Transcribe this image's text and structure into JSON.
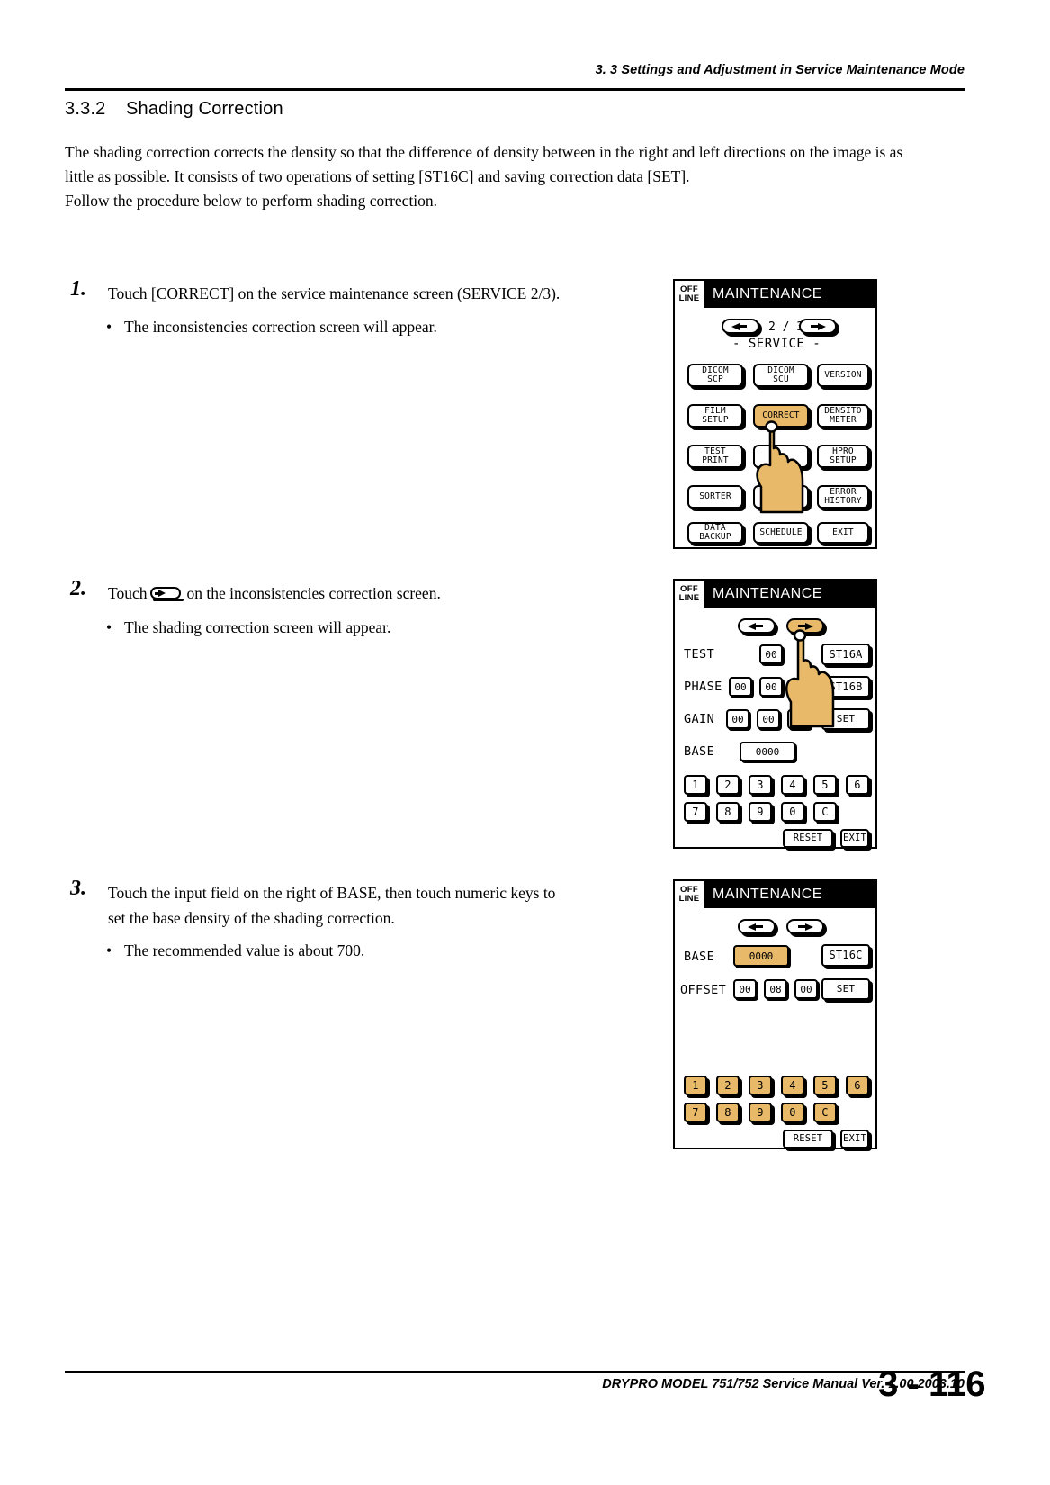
{
  "header": {
    "running_head": "3. 3 Settings and Adjustment in Service Maintenance Mode"
  },
  "section": {
    "number": "3.3.2",
    "title": "Shading Correction"
  },
  "intro": {
    "line1": "The shading correction corrects the density so that the difference of density between in the right and left directions on the image is as",
    "line2": "little as possible. It consists of two operations of setting [ST16C] and saving correction data [SET].",
    "line3": "Follow the procedure below to perform shading correction."
  },
  "steps": [
    {
      "number": "1.",
      "text": "Touch [CORRECT] on the service maintenance screen (SERVICE 2/3).",
      "bullet": "The inconsistencies correction screen will appear."
    },
    {
      "number": "2.",
      "text_before": "Touch",
      "text_after": "on the inconsistencies correction screen.",
      "bullet": "The shading correction screen will appear."
    },
    {
      "number": "3.",
      "text_line1": "Touch the input field on the right of BASE, then touch numeric keys to",
      "text_line2": "set the base density of the shading correction.",
      "bullet": "The recommended value is about 700."
    }
  ],
  "panel1": {
    "offline": {
      "line1": "OFF",
      "line2": "LINE"
    },
    "title": "MAINTENANCE",
    "page_indicator": "2 / 3",
    "service_label": "- SERVICE -",
    "buttons": [
      {
        "label1": "DICOM",
        "label2": "SCP",
        "highlight": false
      },
      {
        "label1": "DICOM",
        "label2": "SCU",
        "highlight": false
      },
      {
        "label1": "VERSION",
        "label2": "",
        "highlight": false
      },
      {
        "label1": "FILM",
        "label2": "SETUP",
        "highlight": false
      },
      {
        "label1": "CORRECT",
        "label2": "",
        "highlight": true
      },
      {
        "label1": "DENSITO",
        "label2": "METER",
        "highlight": false
      },
      {
        "label1": "TEST",
        "label2": "PRINT",
        "highlight": false
      },
      {
        "label1": "",
        "label2": "",
        "highlight": false
      },
      {
        "label1": "HPRO",
        "label2": "SETUP",
        "highlight": false
      },
      {
        "label1": "SORTER",
        "label2": "",
        "highlight": false
      },
      {
        "label1": "",
        "label2": "",
        "highlight": false
      },
      {
        "label1": "ERROR",
        "label2": "HISTORY",
        "highlight": false
      },
      {
        "label1": "DATA",
        "label2": "BACKUP",
        "highlight": false
      },
      {
        "label1": "SCHEDULE",
        "label2": "",
        "highlight": false
      },
      {
        "label1": "EXIT",
        "label2": "",
        "highlight": false
      }
    ]
  },
  "panel2": {
    "offline": {
      "line1": "OFF",
      "line2": "LINE"
    },
    "title": "MAINTENANCE",
    "rows": [
      {
        "label": "TEST",
        "values": [
          "00"
        ],
        "action": "ST16A"
      },
      {
        "label": "PHASE",
        "values": [
          "00",
          "00"
        ],
        "action": "ST16B"
      },
      {
        "label": "GAIN",
        "values": [
          "00",
          "00",
          "00"
        ],
        "action": "SET"
      },
      {
        "label": "BASE",
        "values": [
          "0000"
        ],
        "action": ""
      }
    ],
    "keypad_row1": [
      "1",
      "2",
      "3",
      "4",
      "5",
      "6"
    ],
    "keypad_row2": [
      "7",
      "8",
      "9",
      "0",
      "C"
    ],
    "reset_label": "RESET",
    "exit_label": "EXIT"
  },
  "panel3": {
    "offline": {
      "line1": "OFF",
      "line2": "LINE"
    },
    "title": "MAINTENANCE",
    "rows": [
      {
        "label": "BASE",
        "values": [
          "0000"
        ],
        "action": "ST16C",
        "value_highlight": true
      },
      {
        "label": "OFFSET",
        "values": [
          "00",
          "08",
          "00"
        ],
        "action": "SET",
        "value_highlight": false
      }
    ],
    "keypad_row1": [
      "1",
      "2",
      "3",
      "4",
      "5",
      "6"
    ],
    "keypad_row2": [
      "7",
      "8",
      "9",
      "0",
      "C"
    ],
    "reset_label": "RESET",
    "exit_label": "EXIT"
  },
  "footer": {
    "manual_text": "DRYPRO MODEL 751/752 Service Manual Ver. 1.00 2003.10",
    "page_number": "3 - 116"
  },
  "colors": {
    "highlight": "#e8b968",
    "hand": "#e8b968",
    "ink": "#000000",
    "paper": "#ffffff"
  }
}
